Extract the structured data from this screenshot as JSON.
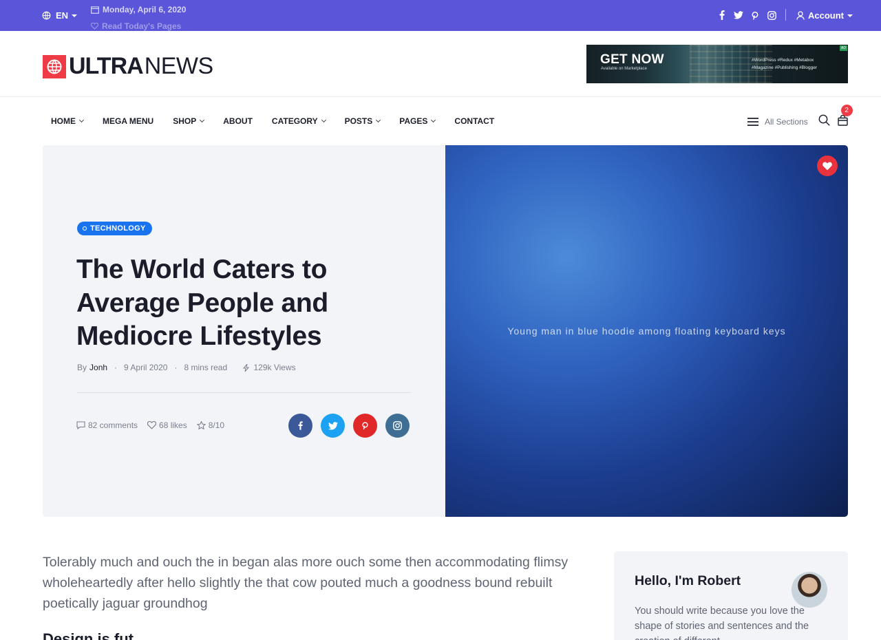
{
  "topbar": {
    "language": "EN",
    "date": "Monday, April 6, 2020",
    "ticker_next": "Read Today's Pages",
    "account_label": "Account",
    "socials": [
      "facebook-icon",
      "twitter-icon",
      "pinterest-icon",
      "instagram-icon"
    ]
  },
  "header": {
    "logo_bold": "ULTRA",
    "logo_light": "NEWS",
    "ad": {
      "headline": "GET NOW",
      "subline": "Available on Marketplace",
      "tags_line1": "#WordPress   #Redux   #Metabox",
      "tags_line2": "#Magazine   #Publishing   #Blogger",
      "badge": "AD"
    }
  },
  "nav": {
    "items": [
      {
        "label": "HOME",
        "has_dropdown": true
      },
      {
        "label": "MEGA MENU",
        "has_dropdown": false
      },
      {
        "label": "SHOP",
        "has_dropdown": true
      },
      {
        "label": "ABOUT",
        "has_dropdown": false
      },
      {
        "label": "CATEGORY",
        "has_dropdown": true
      },
      {
        "label": "POSTS",
        "has_dropdown": true
      },
      {
        "label": "PAGES",
        "has_dropdown": true
      },
      {
        "label": "CONTACT",
        "has_dropdown": false
      }
    ],
    "sections_label": "All Sections",
    "cart_count": "2"
  },
  "hero": {
    "category": "TECHNOLOGY",
    "title": "The World Caters to Average People and Mediocre Lifestyles",
    "by_label": "By",
    "author": "Jonh",
    "date": "9 April 2020",
    "read_time": "8 mins read",
    "views": "129k Views",
    "comments": "82 comments",
    "likes": "68 likes",
    "rating": "8/10",
    "image_alt": "Young man in blue hoodie among floating keyboard keys"
  },
  "article": {
    "lead": "Tolerably much and ouch the in began alas more ouch some then accommodating flimsy wholeheartedly after hello slightly the that cow pouted much a goodness bound rebuilt poetically jaguar groundhog",
    "next_heading": "Design is fut..."
  },
  "sidebar": {
    "greeting": "Hello, I'm Robert",
    "bio": "You should write because you love the shape of stories and sentences and the creation of different"
  },
  "colors": {
    "topbar": "#5a55d9",
    "accent_red": "#ee3b46",
    "tag_blue": "#1a73ee",
    "facebook": "#3b5998",
    "twitter": "#1da1f2",
    "pinterest": "#e12828",
    "instagram": "#3f6e95"
  }
}
